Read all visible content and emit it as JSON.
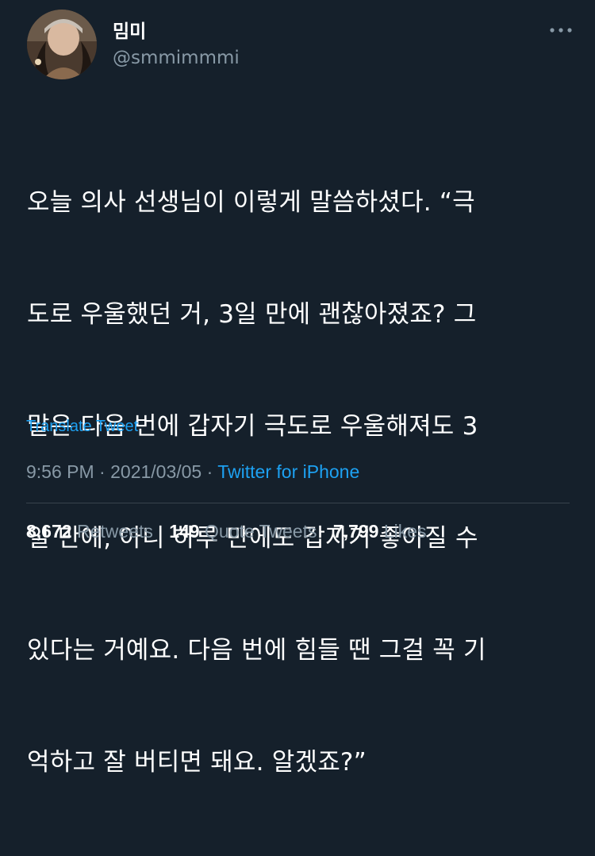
{
  "user": {
    "display_name": "밈미",
    "handle": "@smmimmmi"
  },
  "tweet": {
    "lines": [
      "오늘 의사 선생님이 이렇게 말씀하셨다. “극",
      "도로 우울했던 거, 3일 만에 괜찮아졌죠? 그",
      "말은 다음 번에 갑자기 극도로 우울해져도 3",
      "일 만에, 아니 하루 만에도 갑자기 좋아질 수",
      "있다는 거예요. 다음 번에 힘들 땐 그걸 꼭 기",
      "억하고 잘 버티면 돼요. 알겠죠?”"
    ]
  },
  "translate_label": "Translate Tweet",
  "meta": {
    "time": "9:56 PM",
    "separator": " · ",
    "date": "2021/03/05",
    "source": "Twitter for iPhone"
  },
  "stats": {
    "retweets": {
      "count": "8,672",
      "label": "Retweets"
    },
    "quotes": {
      "count": "149",
      "label": "Quote Tweets"
    },
    "likes": {
      "count": "7,799",
      "label": "Likes"
    }
  },
  "icons": {
    "more": "more-horizontal-icon"
  },
  "colors": {
    "background": "#15202b",
    "primary_text": "#ffffff",
    "secondary_text": "#8899a6",
    "accent": "#1da1f2",
    "divider": "#38444d"
  }
}
